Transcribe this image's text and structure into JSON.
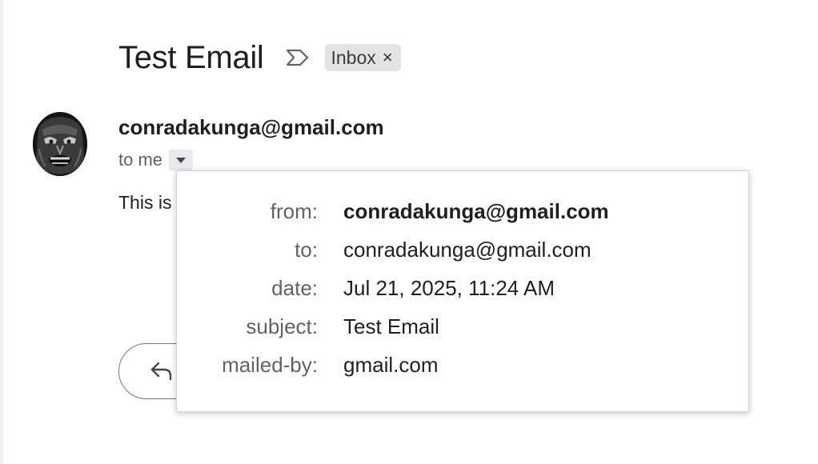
{
  "email": {
    "subject": "Test Email",
    "label_chip": "Inbox",
    "label_close_glyph": "×",
    "important_icon": "importance-marker-icon",
    "sender_email": "conradakunga@gmail.com",
    "recipients_text": "to me",
    "details_toggle_icon": "caret-down-icon",
    "body_snippet": "This is",
    "reply_icon": "reply-arrow-icon",
    "avatar": "sender-avatar-image"
  },
  "details": {
    "rows": [
      {
        "label": "from:",
        "value": "conradakunga@gmail.com"
      },
      {
        "label": "to:",
        "value": "conradakunga@gmail.com"
      },
      {
        "label": "date:",
        "value": "Jul 21, 2025, 11:24 AM"
      },
      {
        "label": "subject:",
        "value": "Test Email"
      },
      {
        "label": "mailed-by:",
        "value": "gmail.com"
      }
    ]
  },
  "colors": {
    "text_primary": "#1f1f1f",
    "text_secondary": "#5f6368",
    "chip_background": "#e3e3e3",
    "toggle_background": "#e8eaed",
    "popup_border": "#d2d2d2"
  }
}
